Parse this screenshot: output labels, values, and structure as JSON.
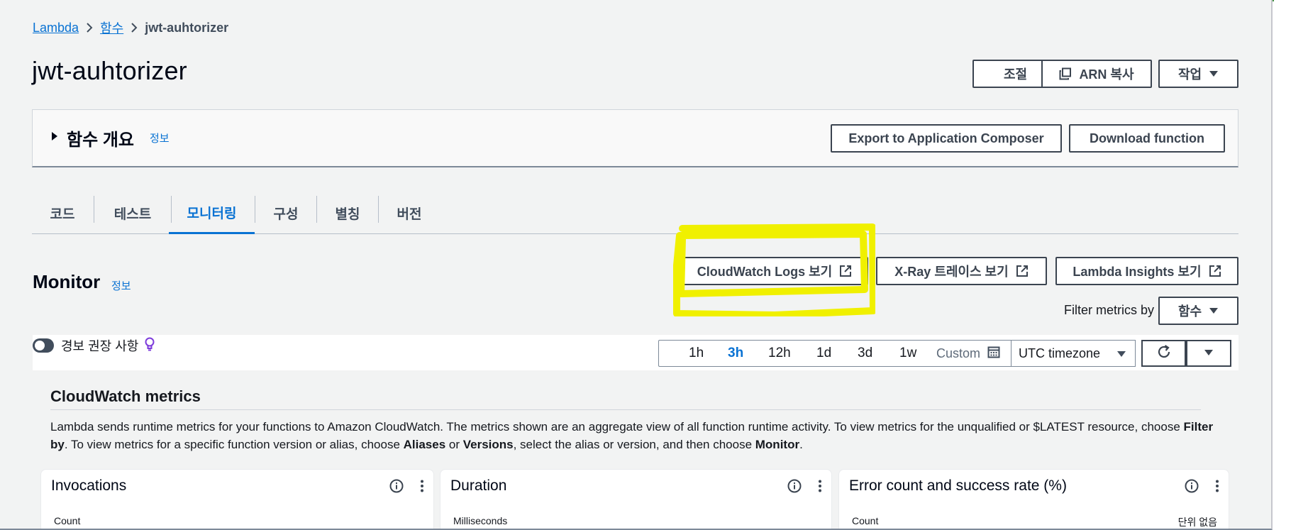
{
  "breadcrumb": {
    "items": [
      "Lambda",
      "함수"
    ],
    "current": "jwt-auhtorizer"
  },
  "page": {
    "title": "jwt-auhtorizer",
    "actions": {
      "throttle": "조절",
      "copy_arn": "ARN 복사",
      "actions": "작업"
    }
  },
  "overview": {
    "title": "함수 개요",
    "info": "정보",
    "export": "Export to Application Composer",
    "download": "Download function"
  },
  "tabs": [
    "코드",
    "테스트",
    "모니터링",
    "구성",
    "별칭",
    "버전"
  ],
  "active_tab": "모니터링",
  "monitor": {
    "title": "Monitor",
    "info": "정보",
    "cloudwatch_logs": "CloudWatch Logs 보기",
    "xray": "X-Ray 트레이스 보기",
    "insights": "Lambda Insights 보기",
    "filter_label": "Filter metrics by",
    "filter_value": "함수",
    "alarm_label": "경보 권장 사항",
    "ranges": [
      "1h",
      "3h",
      "12h",
      "1d",
      "3d",
      "1w"
    ],
    "selected_range": "3h",
    "custom": "Custom",
    "timezone": "UTC timezone"
  },
  "cloudwatch": {
    "title": "CloudWatch metrics",
    "desc": {
      "p1": "Lambda sends runtime metrics for your functions to Amazon CloudWatch. The metrics shown are an aggregate view of all function runtime activity. To view metrics for the unqualified or $LATEST resource, choose ",
      "b1": "Filter by",
      "p2": ". To view metrics for a specific function version or alias, choose ",
      "b2": "Aliases",
      "p3": " or ",
      "b3": "Versions",
      "p4": ", select the alias or version, and then choose ",
      "b4": "Monitor",
      "p5": "."
    }
  },
  "cards": [
    {
      "title": "Invocations",
      "unit": "Count"
    },
    {
      "title": "Duration",
      "unit": "Milliseconds"
    },
    {
      "title": "Error count and success rate (%)",
      "unit": "Count",
      "right_unit": "단위 없음"
    }
  ],
  "colors": {
    "link": "#0972d3",
    "button_border": "#3b4450",
    "highlight": "#f0f000"
  }
}
